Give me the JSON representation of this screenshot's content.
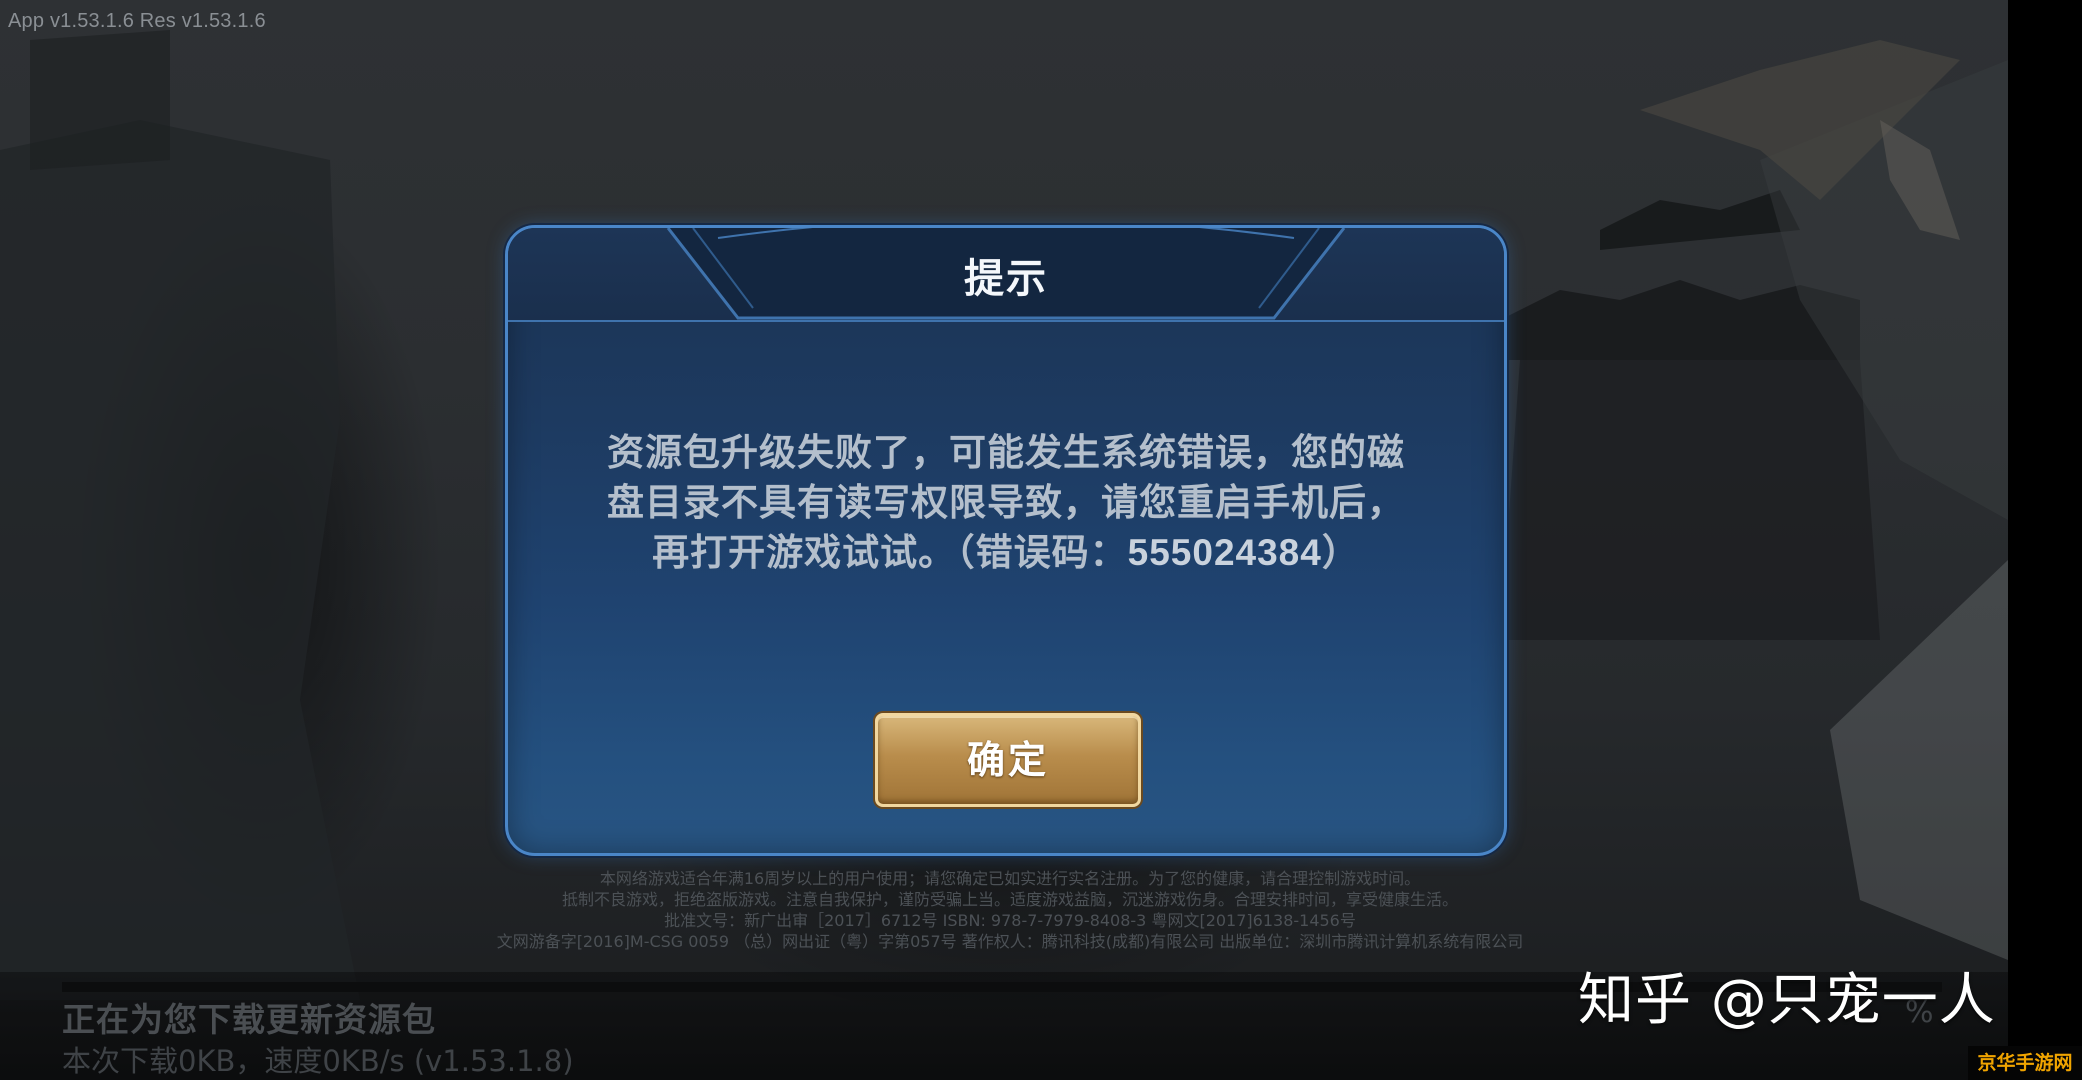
{
  "version_text": "App v1.53.1.6   Res v1.53.1.6",
  "dialog": {
    "title": "提示",
    "message_line1": "资源包升级失败了，可能发生系统错误，您的磁",
    "message_line2": "盘目录不具有读写权限导致，请您重启手机后，",
    "message_line3_prefix": "再打开游戏试试。（错误码：",
    "error_code": "555024384",
    "message_line3_suffix": "）",
    "confirm_label": "确定"
  },
  "legal": {
    "line1": "本网络游戏适合年满16周岁以上的用户使用；请您确定已如实进行实名注册。为了您的健康，请合理控制游戏时间。",
    "line2": "抵制不良游戏，拒绝盗版游戏。注意自我保护，谨防受骗上当。适度游戏益脑，沉迷游戏伤身。合理安排时间，享受健康生活。",
    "line3": "批准文号：新广出审［2017］6712号 ISBN: 978-7-7979-8408-3 粤网文[2017]6138-1456号",
    "line4": "文网游备字[2016]M-CSG 0059 （总）网出证（粤）字第057号 著作权人：腾讯科技(成都)有限公司 出版单位：深圳市腾讯计算机系统有限公司"
  },
  "download": {
    "title": "正在为您下载更新资源包",
    "info": "本次下载0KB，速度0KB/s (v1.53.1.8)",
    "percent": "%"
  },
  "watermarks": {
    "zhihu": "知乎 @只宠一人",
    "corner": "京华手游网"
  },
  "colors": {
    "dialog_border": "#4a86c8",
    "dialog_bg": "#1f4370",
    "button_gold": "#b98d4c",
    "corner_watermark": "#f0a400"
  }
}
